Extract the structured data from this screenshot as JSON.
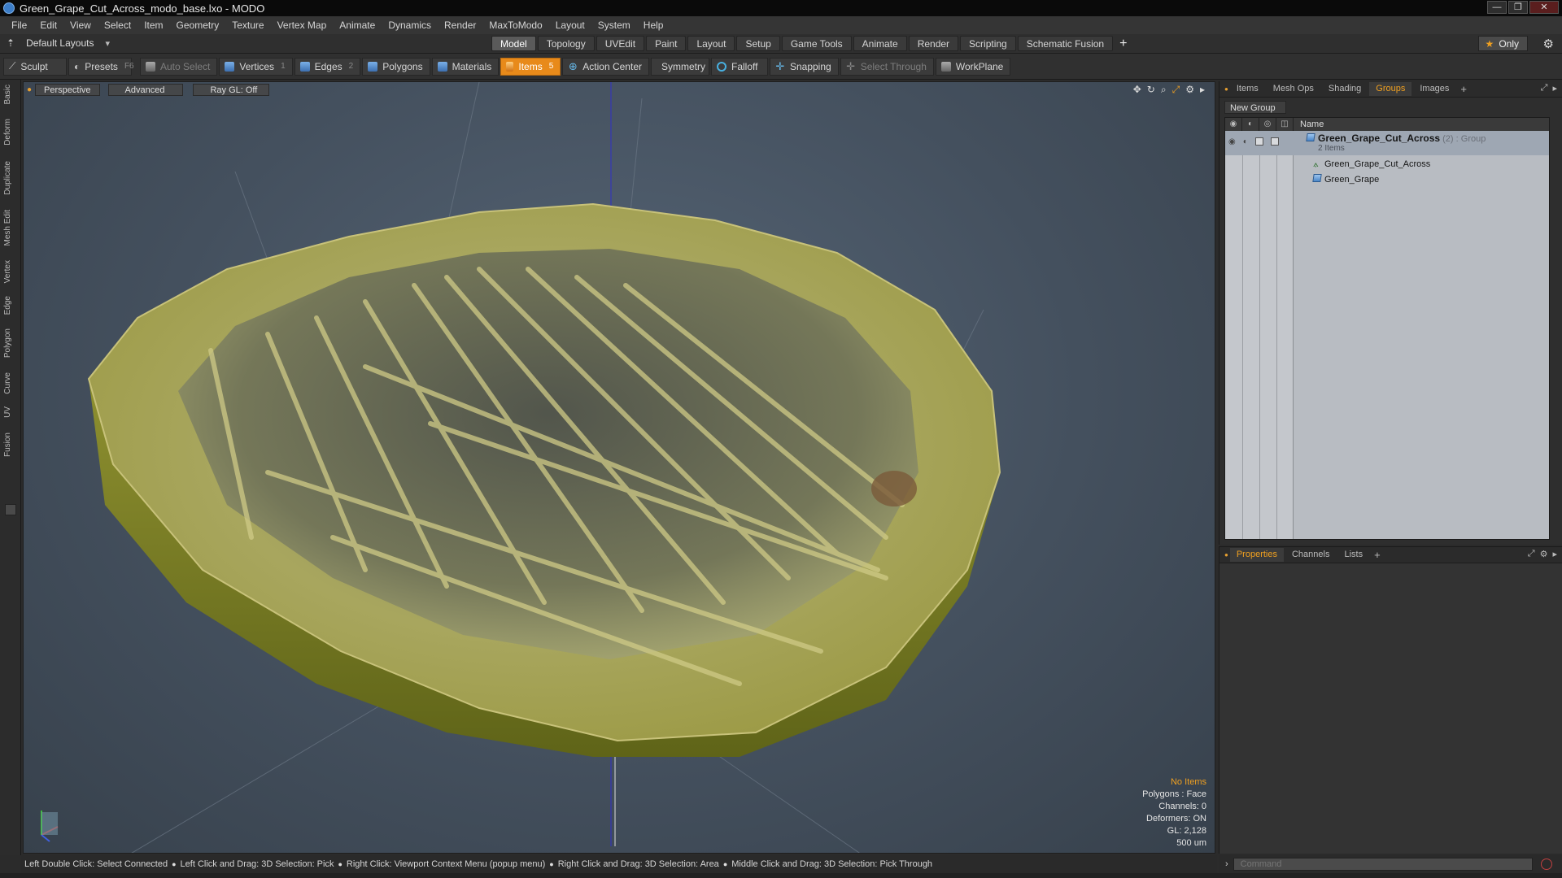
{
  "window": {
    "title": "Green_Grape_Cut_Across_modo_base.lxo - MODO"
  },
  "menu": [
    "File",
    "Edit",
    "View",
    "Select",
    "Item",
    "Geometry",
    "Texture",
    "Vertex Map",
    "Animate",
    "Dynamics",
    "Render",
    "MaxToModo",
    "Layout",
    "System",
    "Help"
  ],
  "layouts": {
    "selector": "Default Layouts",
    "tabs": [
      "Model",
      "Topology",
      "UVEdit",
      "Paint",
      "Layout",
      "Setup",
      "Game Tools",
      "Animate",
      "Render",
      "Scripting",
      "Schematic Fusion"
    ],
    "active_tab": "Model",
    "only_label": "Only"
  },
  "toolbar": {
    "sculpt": "Sculpt",
    "presets": "Presets",
    "presets_key": "F6",
    "auto_select": "Auto Select",
    "vertices": "Vertices",
    "vertices_key": "1",
    "edges": "Edges",
    "edges_key": "2",
    "polygons": "Polygons",
    "materials": "Materials",
    "items": "Items",
    "items_key": "5",
    "action_center": "Action Center",
    "symmetry": "Symmetry",
    "falloff": "Falloff",
    "snapping": "Snapping",
    "select_through": "Select Through",
    "workplane": "WorkPlane"
  },
  "left_tabs": [
    "Basic",
    "Deform",
    "Duplicate",
    "Mesh Edit",
    "Vertex",
    "Edge",
    "Polygon",
    "Curve",
    "UV",
    "Fusion"
  ],
  "viewport": {
    "view_mode": "Perspective",
    "shading": "Advanced",
    "raygl": "Ray GL: Off",
    "stats": {
      "selection": "No Items",
      "polygons": "Polygons : Face",
      "channels": "Channels: 0",
      "deformers": "Deformers: ON",
      "gl": "GL: 2,128",
      "scale": "500 um"
    }
  },
  "groups_panel": {
    "tabs": [
      "Items",
      "Mesh Ops",
      "Shading",
      "Groups",
      "Images"
    ],
    "active_tab": "Groups",
    "new_group": "New Group",
    "column_name": "Name",
    "group": {
      "name": "Green_Grape_Cut_Across",
      "count": "(2)",
      "type": ": Group",
      "subtitle": "2 Items",
      "children": [
        "Green_Grape_Cut_Across",
        "Green_Grape"
      ]
    }
  },
  "properties_panel": {
    "tabs": [
      "Properties",
      "Channels",
      "Lists"
    ],
    "active_tab": "Properties"
  },
  "statusbar": {
    "hints": [
      "Left Double Click: Select Connected",
      "Left Click and Drag: 3D Selection: Pick",
      "Right Click: Viewport Context Menu (popup menu)",
      "Right Click and Drag: 3D Selection: Area",
      "Middle Click and Drag: 3D Selection: Pick Through"
    ]
  },
  "command": {
    "placeholder": "Command"
  },
  "colors": {
    "accent": "#f0a020",
    "active_tool": "#e88a1a",
    "viewport_bg": "#4a5663",
    "grape": "#b8b85a"
  }
}
